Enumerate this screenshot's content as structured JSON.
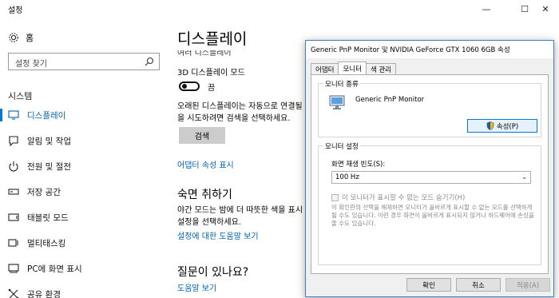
{
  "window": {
    "title": "설정",
    "controls": {
      "minimize": "—",
      "maximize": "☐",
      "close": "✕"
    }
  },
  "sidebar": {
    "home_label": "홈",
    "search_placeholder": "설정 찾기",
    "section_label": "시스템",
    "items": [
      {
        "label": "디스플레이",
        "icon": "monitor-icon",
        "active": true
      },
      {
        "label": "알림 및 작업",
        "icon": "notification-icon",
        "active": false
      },
      {
        "label": "전원 및 절전",
        "icon": "power-icon",
        "active": false
      },
      {
        "label": "저장 공간",
        "icon": "storage-icon",
        "active": false
      },
      {
        "label": "태블릿 모드",
        "icon": "tablet-icon",
        "active": false
      },
      {
        "label": "멀티태스킹",
        "icon": "multitasking-icon",
        "active": false
      },
      {
        "label": "PC에 화면 표시",
        "icon": "project-icon",
        "active": false
      },
      {
        "label": "공유 환경",
        "icon": "shared-icon",
        "active": false
      }
    ]
  },
  "main": {
    "title": "디스플레이",
    "partial_hidden_text": "여러 디스플레이",
    "mode_3d_label": "3D 디스플레이 모드",
    "toggle_state": "끔",
    "desc1_line1": "오래된 디스플레이는 자동으로 연결될",
    "desc1_line2": "을 시도하려면 검색을 선택하세요.",
    "search_button": "검색",
    "adapter_link": "어댑터 속성 표시",
    "night_heading": "숙면 취하기",
    "night_desc_line1": "야간 모드는 밤에 더 따뜻한 색을 표시",
    "night_desc_line2": "설정을 선택하세요.",
    "night_help_link": "설정에 대한 도움말 보기",
    "question_heading": "질문이 있나요?",
    "help_link": "도움말 보기"
  },
  "dialog": {
    "title": "Generic PnP Monitor 및 NVIDIA GeForce GTX 1060 6GB 속성",
    "tabs": [
      "어댑터",
      "모니터",
      "색 관리"
    ],
    "active_tab": "모니터",
    "monitor_type_group": "모니터 종류",
    "monitor_name": "Generic PnP Monitor",
    "properties_button": "속성(P)",
    "monitor_settings_group": "모니터 설정",
    "refresh_rate_label": "화면 재생 빈도(S):",
    "refresh_rate_value": "100 Hz",
    "hide_modes_label": "이 모니터가 표시할 수 없는 모드 숨기기(H)",
    "warning_text": "이 확인란의 선택을 해제하면 모니터가 올바르게 표시할 수 없는 모드를 선택하게 될 수도 있습니다. 이런 경우 화면이 올바르게 표시되지 않거나 하드웨어에 손상을 줄 수도 있습니다.",
    "ok_button": "확인",
    "cancel_button": "취소",
    "apply_button": "적용(A)"
  },
  "colors": {
    "accent": "#0078d7",
    "link": "#0063b1"
  }
}
